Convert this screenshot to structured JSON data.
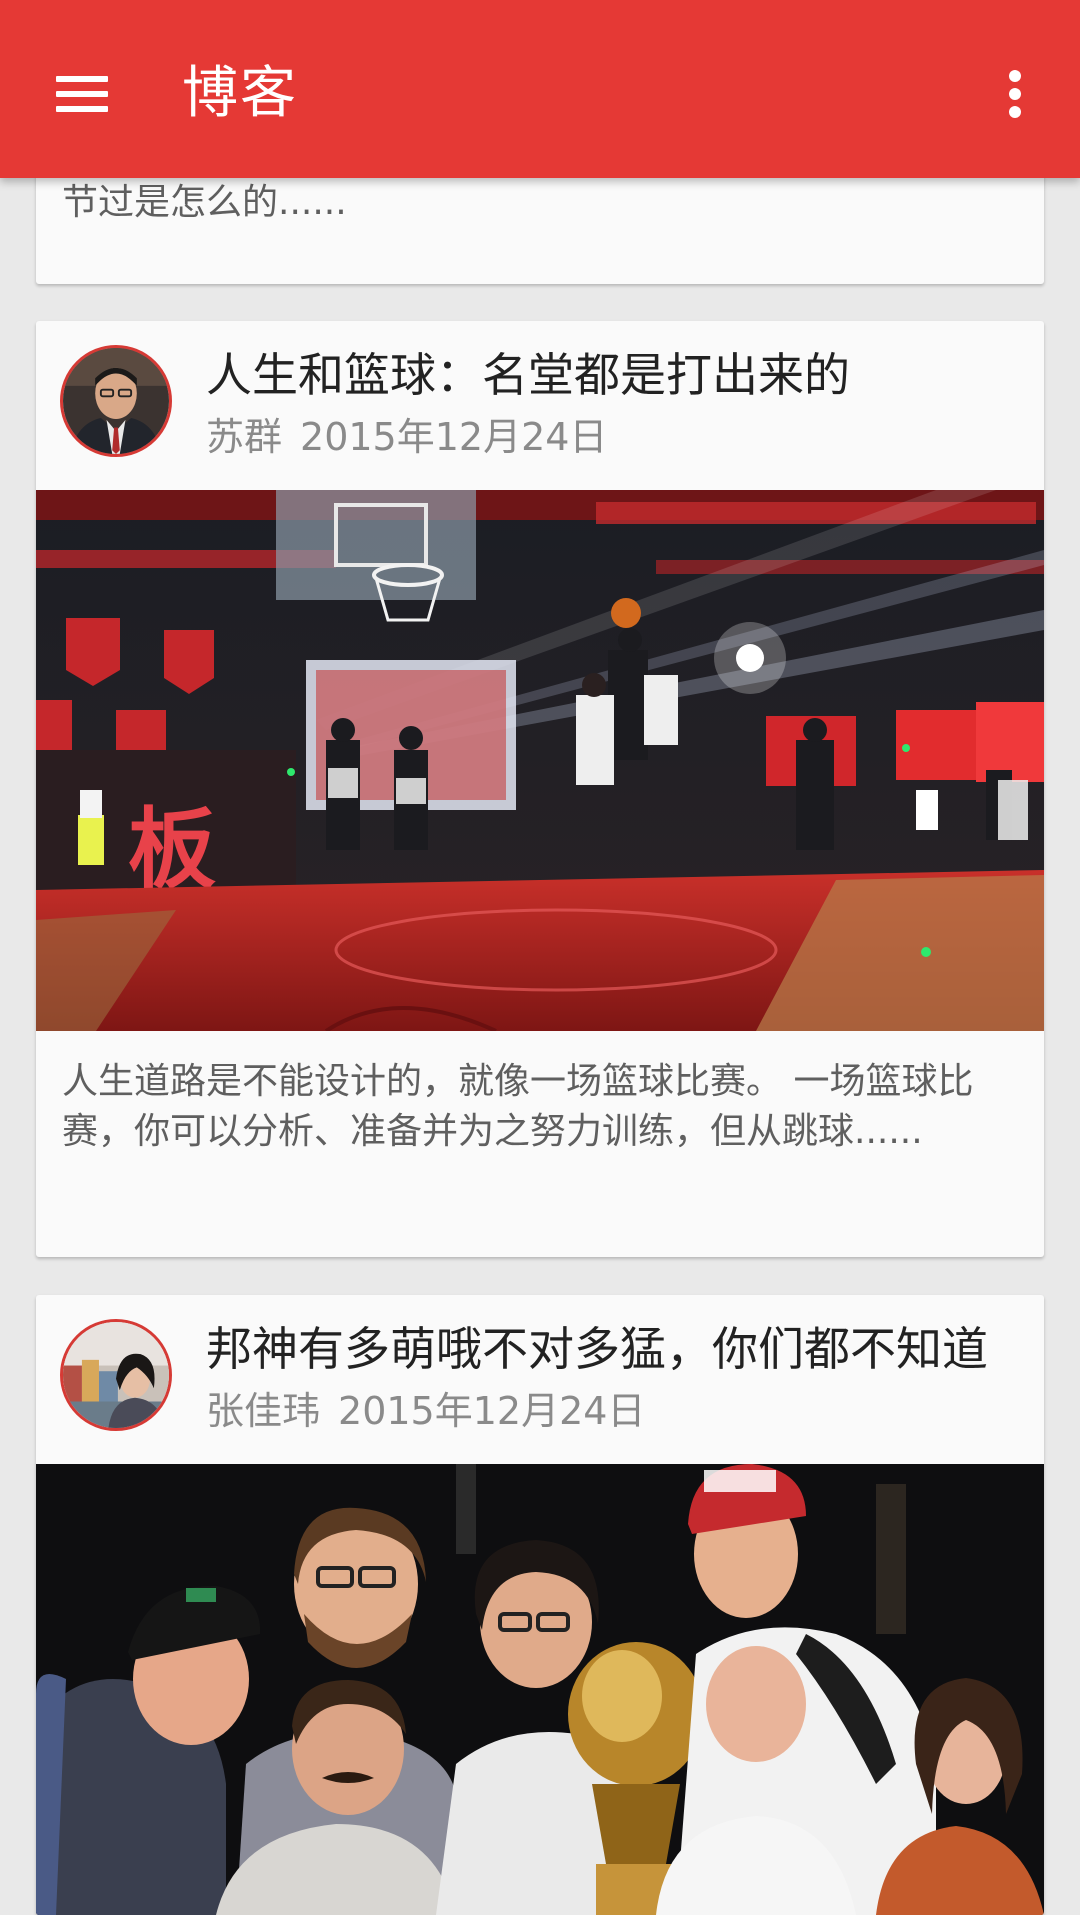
{
  "app_bar": {
    "title": "博客",
    "menu_icon": "hamburger-menu-icon",
    "overflow_icon": "more-vert-icon",
    "color": "#e53935"
  },
  "posts": [
    {
      "excerpt": "节过是怎么的......"
    },
    {
      "title": "人生和篮球：名堂都是打出来的",
      "author": "苏群",
      "date": "2015年12月24日",
      "excerpt": "人生道路是不能设计的，就像一场篮球比赛。 一场篮球比赛，你可以分析、准备并为之努力训练，但从跳球......",
      "image": "basketball-game-photo",
      "image_text": "板"
    },
    {
      "title": "邦神有多萌哦不对多猛，你们都不知道",
      "author": "张佳玮",
      "date": "2015年12月24日",
      "image": "group-with-trophy-photo"
    }
  ]
}
